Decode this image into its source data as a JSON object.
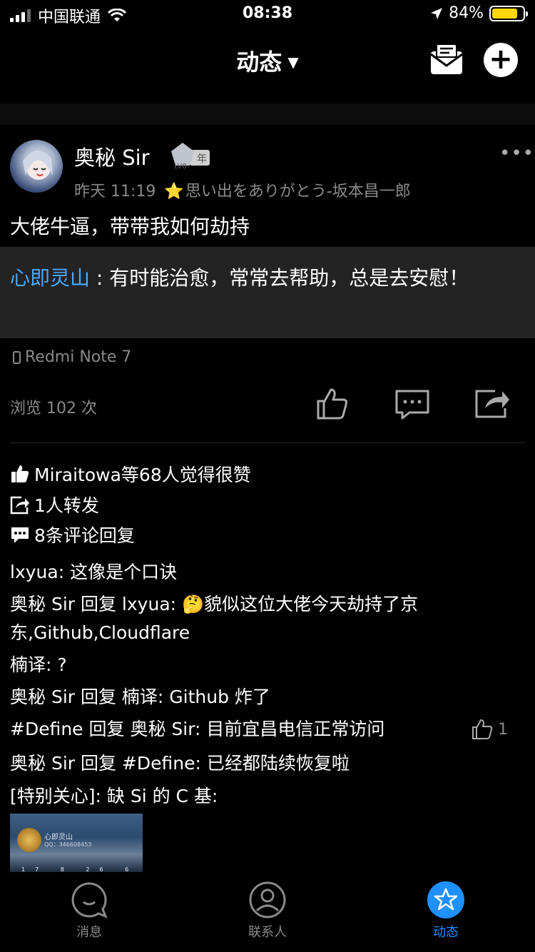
{
  "status_bar": {
    "carrier": "中国联通",
    "time": "08:38",
    "battery": "84%",
    "battery_level": 84
  },
  "nav": {
    "title": "动态",
    "caret": "▼"
  },
  "post": {
    "username": "奥秘 Sir",
    "badge": {
      "level": "LV8",
      "suffix": "年"
    },
    "time": "昨天 11:19",
    "signature_star": "⭐",
    "signature": "思い出をありがとう-坂本昌一郎",
    "more": "•••",
    "content": "大佬牛逼，带带我如何劫持",
    "repost": {
      "author": "心即灵山",
      "separator": " : ",
      "text": "有时能治愈，常常去帮助，总是去安慰！"
    },
    "device": "Redmi Note 7",
    "views": "浏览 102 次"
  },
  "stats": {
    "likes": "Miraitowa等68人觉得很赞",
    "shares": "1人转发",
    "comments": "8条评论回复"
  },
  "comments": [
    {
      "text": "lxyua: 这像是个口诀"
    },
    {
      "text": "奥秘 Sir 回复 lxyua: 🤔貌似这位大佬今天劫持了京东,Github,Cloudflare"
    },
    {
      "text": "楠译: ?"
    },
    {
      "text": "奥秘 Sir 回复 楠译: Github 炸了"
    },
    {
      "text": "#Define 回复 奥秘 Sir: 目前宜昌电信正常访问",
      "likes": "1"
    },
    {
      "text": "奥秘 Sir 回复 #Define: 已经都陆续恢复啦"
    },
    {
      "text": "[特别关心]: 缺 Si 的 C 基:"
    }
  ],
  "thumbnail": {
    "name": "心即灵山",
    "qq": "QQ：346608453",
    "stats": "17 8 26 6 13132"
  },
  "tabs": [
    {
      "label": "消息",
      "active": false
    },
    {
      "label": "联系人",
      "active": false
    },
    {
      "label": "动态",
      "active": true
    }
  ],
  "colors": {
    "accent": "#1e90ff",
    "link_blue": "#4aa8ff",
    "battery": "#ffd60a",
    "muted": "#8a8a8a"
  }
}
